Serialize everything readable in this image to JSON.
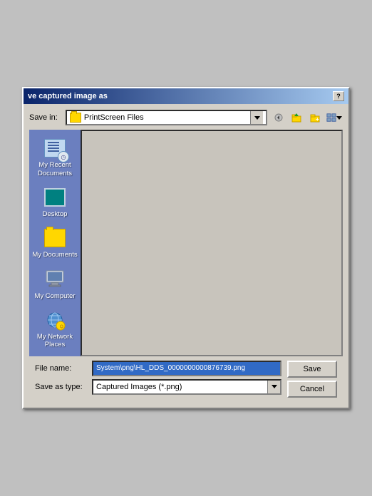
{
  "dialog": {
    "title": "ve captured image as",
    "help_label": "?"
  },
  "toolbar": {
    "save_in_label": "Save in:",
    "folder_name": "PrintScreen Files",
    "back_btn": "◄",
    "up_btn": "↑",
    "new_folder_btn": "📁",
    "view_btn": "☰"
  },
  "sidebar": {
    "items": [
      {
        "id": "recent",
        "label": "My Recent\nDocuments",
        "icon": "recent-icon"
      },
      {
        "id": "desktop",
        "label": "Desktop",
        "icon": "desktop-icon"
      },
      {
        "id": "documents",
        "label": "My Documents",
        "icon": "documents-icon"
      },
      {
        "id": "computer",
        "label": "My Computer",
        "icon": "computer-icon"
      },
      {
        "id": "network",
        "label": "My Network\nPlaces",
        "icon": "network-icon"
      }
    ]
  },
  "bottom": {
    "filename_label": "File name:",
    "filename_value": "System\\png\\HL_DDS_0000000000876739.png",
    "savetype_label": "Save as type:",
    "savetype_value": "Captured Images (*.png)",
    "save_btn": "Save",
    "cancel_btn": "Cancel"
  }
}
